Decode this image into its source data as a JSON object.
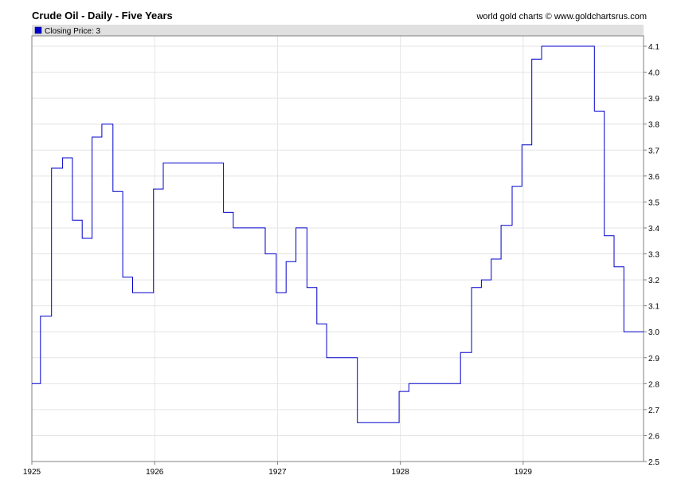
{
  "header": {
    "title": "Crude Oil - Daily - Five Years",
    "source": "world gold charts © www.goldchartsrus.com"
  },
  "legend": {
    "label": "Closing Price: 3"
  },
  "colors": {
    "series": "#0000cc",
    "legend_band": "#e0e0e0",
    "grid": "#e4e4e4",
    "axis": "#808080"
  },
  "chart_data": {
    "type": "line",
    "title": "Crude Oil - Daily - Five Years",
    "xlabel": "",
    "ylabel": "",
    "xlim": [
      1925.0,
      1929.98
    ],
    "ylim": [
      2.5,
      4.1
    ],
    "x_ticks": [
      "1925",
      "1926",
      "1927",
      "1928",
      "1929"
    ],
    "y_ticks": [
      "2.5",
      "2.6",
      "2.7",
      "2.8",
      "2.9",
      "3.0",
      "3.1",
      "3.2",
      "3.3",
      "3.4",
      "3.5",
      "3.6",
      "3.7",
      "3.8",
      "3.9",
      "4.0",
      "4.1"
    ],
    "grid": true,
    "legend_position": "top-left",
    "series": [
      {
        "name": "Closing Price: 3",
        "step": true,
        "x": [
          1925.0,
          1925.07,
          1925.16,
          1925.25,
          1925.33,
          1925.41,
          1925.49,
          1925.57,
          1925.66,
          1925.74,
          1925.82,
          1925.99,
          1926.07,
          1926.56,
          1926.64,
          1926.9,
          1926.99,
          1927.07,
          1927.15,
          1927.24,
          1927.32,
          1927.4,
          1927.65,
          1927.99,
          1928.07,
          1928.49,
          1928.58,
          1928.66,
          1928.74,
          1928.82,
          1928.91,
          1928.99,
          1929.07,
          1929.15,
          1929.58,
          1929.66,
          1929.74,
          1929.82,
          1929.98
        ],
        "y": [
          2.8,
          3.06,
          3.63,
          3.67,
          3.43,
          3.36,
          3.75,
          3.8,
          3.54,
          3.21,
          3.15,
          3.55,
          3.65,
          3.46,
          3.4,
          3.3,
          3.15,
          3.27,
          3.4,
          3.17,
          3.03,
          2.9,
          2.65,
          2.77,
          2.8,
          2.92,
          3.17,
          3.2,
          3.28,
          3.41,
          3.56,
          3.72,
          4.05,
          4.1,
          3.85,
          3.37,
          3.25,
          3.0,
          3.0
        ]
      }
    ]
  }
}
